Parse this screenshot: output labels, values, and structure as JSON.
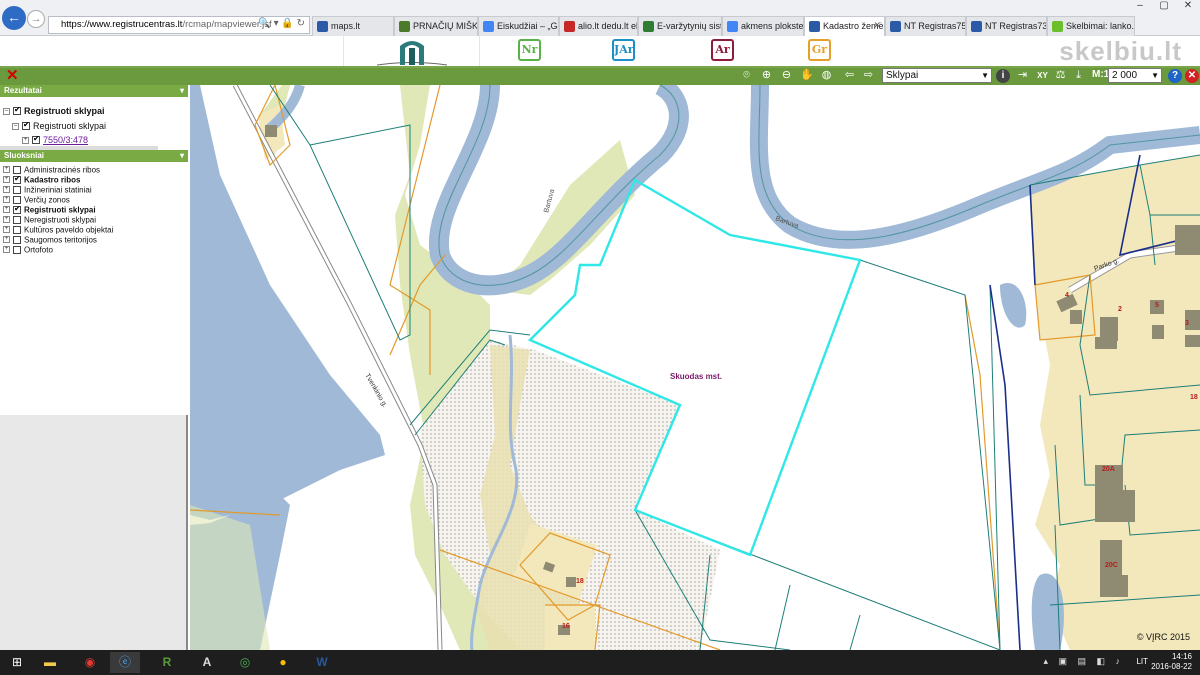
{
  "browser": {
    "url_host": "https://www.registrucentras.lt",
    "url_path": "/rcmap/mapviewer.jsf",
    "tabs": [
      {
        "label": "maps.lt",
        "color": "#2b5aa6"
      },
      {
        "label": "PRNAČIŲ MIŠKO ...",
        "color": "#4a7a2a"
      },
      {
        "label": "Eiskudžiai – „Goo...",
        "color": "#4285f4"
      },
      {
        "label": "alio.lt dedu.lt elen...",
        "color": "#c62828"
      },
      {
        "label": "E-varžytynių siste...",
        "color": "#2e7d32"
      },
      {
        "label": "akmens plokstes ...",
        "color": "#4285f4"
      },
      {
        "label": "Kadastro žemė...",
        "color": "#2b5aa6"
      },
      {
        "label": "NT Registras75/862",
        "color": "#2b5aa6"
      },
      {
        "label": "NT Registras73/5...",
        "color": "#2b5aa6"
      },
      {
        "label": "Skelbimai: lanko...",
        "color": "#6bbf2a"
      }
    ],
    "active_tab": 6
  },
  "header": {
    "watermark": "skelbiu.lt",
    "app_icons": [
      {
        "name": "nekilnojamasis-turtas",
        "glyph": "Nr",
        "color": "#5bb14a"
      },
      {
        "name": "juridiniai-asmenys",
        "glyph": "JAr",
        "color": "#1b8fc6"
      },
      {
        "name": "adresai",
        "glyph": "Ar",
        "color": "#8a1e3b"
      },
      {
        "name": "gyventojai",
        "glyph": "Gr",
        "color": "#e6a02a"
      }
    ]
  },
  "toolbar": {
    "layer_select": "Sklypai",
    "scale_label": "M:1",
    "scale_value": "2 000",
    "coord_label": "XY"
  },
  "results": {
    "header": "Rezultatai",
    "root": "Registruoti sklypai",
    "child": "Registruoti sklypai",
    "parcel": "7550/3:478"
  },
  "layers": {
    "header": "Sluoksniai",
    "items": [
      {
        "label": "Administracinės ribos",
        "checked": false,
        "bold": false
      },
      {
        "label": "Kadastro ribos",
        "checked": true,
        "bold": true
      },
      {
        "label": "Inžineriniai statiniai",
        "checked": false,
        "bold": false
      },
      {
        "label": "Verčių zonos",
        "checked": false,
        "bold": false
      },
      {
        "label": "Registruoti sklypai",
        "checked": true,
        "bold": true
      },
      {
        "label": "Neregistruoti sklypai",
        "checked": false,
        "bold": false
      },
      {
        "label": "Kultūros paveldo objektai",
        "checked": false,
        "bold": false
      },
      {
        "label": "Saugomos teritorijos",
        "checked": false,
        "bold": false
      },
      {
        "label": "Ortofoto",
        "checked": false,
        "bold": false
      }
    ]
  },
  "map": {
    "place_label": "Skuodas mst.",
    "river_label": "Bartuva",
    "river_label2": "Bartuva",
    "street_label": "Tvenkinio g.",
    "street_label2": "Parko g.",
    "house_numbers": [
      "18",
      "16",
      "4",
      "2",
      "5",
      "18",
      "20A",
      "20C",
      "3"
    ],
    "copyright": "© VĮRC 2015",
    "colors": {
      "water": "#9fb9d6",
      "meadow": "#dfe8b6",
      "urban": "#f3e7bc",
      "selected": "#30e7e8",
      "parcel": "#1e7f78",
      "zone": "#e39a2a"
    }
  },
  "taskbar": {
    "time": "14:16",
    "date": "2016-08-22",
    "lang": "LIT"
  }
}
